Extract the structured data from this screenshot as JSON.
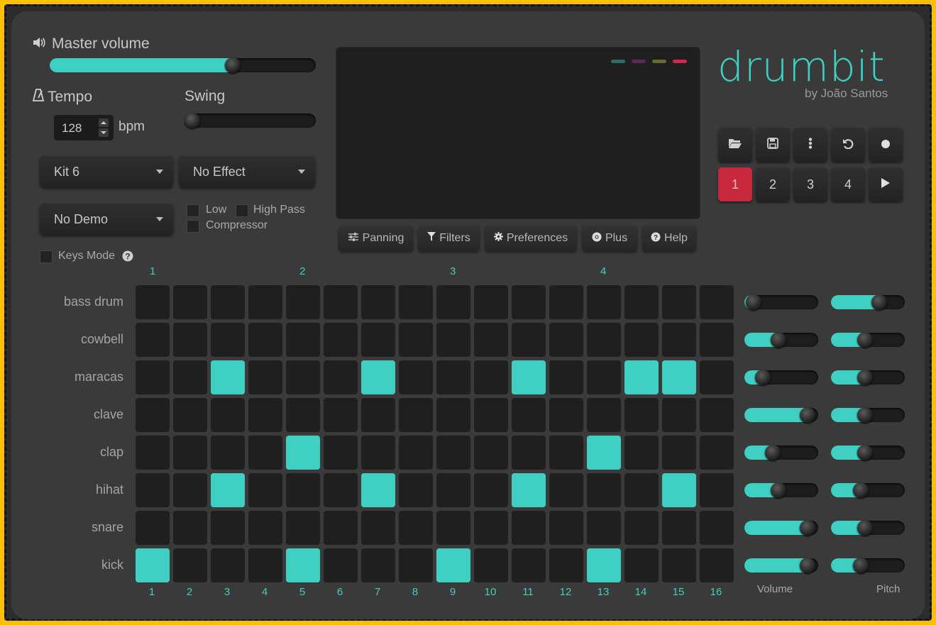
{
  "app": {
    "logo": "drumbit",
    "byline": "by João Santos",
    "accent": "#3fcfc3",
    "record_active": "#c8283b"
  },
  "master_volume": {
    "label": "Master volume",
    "icon": "speaker-icon",
    "level": 0.7
  },
  "tempo": {
    "label": "Tempo",
    "icon": "metronome-icon",
    "value": "128",
    "unit": "bpm"
  },
  "swing": {
    "label": "Swing",
    "level": 0.0
  },
  "selects": {
    "kit": "Kit 6",
    "effect": "No Effect",
    "demo": "No Demo"
  },
  "filters": {
    "low": "Low",
    "high_pass": "High Pass",
    "compressor": "Compressor"
  },
  "keys_mode": {
    "label": "Keys Mode",
    "icon": "help-icon"
  },
  "visualizer_dashes": [
    "#2f6b68",
    "#5a2a55",
    "#6a6a2e",
    "#d0284a"
  ],
  "tabs": [
    {
      "label": "Panning",
      "icon": "sliders-icon"
    },
    {
      "label": "Filters",
      "icon": "filter-icon"
    },
    {
      "label": "Preferences",
      "icon": "gear-icon"
    },
    {
      "label": "Plus",
      "icon": "chrome-icon"
    },
    {
      "label": "Help",
      "icon": "help-icon"
    }
  ],
  "toolbar_icons": [
    "folder-open-icon",
    "save-icon",
    "more-vertical-icon",
    "undo-icon",
    "record-icon"
  ],
  "patterns": [
    "1",
    "2",
    "3",
    "4"
  ],
  "active_pattern": "1",
  "beat_markers": [
    "1",
    "2",
    "3",
    "4"
  ],
  "step_numbers": [
    "1",
    "2",
    "3",
    "4",
    "5",
    "6",
    "7",
    "8",
    "9",
    "10",
    "11",
    "12",
    "13",
    "14",
    "15",
    "16"
  ],
  "tracks": [
    {
      "name": "bass drum",
      "steps": [],
      "volume": 0.02,
      "pitch": 0.7
    },
    {
      "name": "cowbell",
      "steps": [],
      "volume": 0.45,
      "pitch": 0.45
    },
    {
      "name": "maracas",
      "steps": [
        3,
        7,
        11,
        14,
        15
      ],
      "volume": 0.18,
      "pitch": 0.45
    },
    {
      "name": "clave",
      "steps": [],
      "volume": 0.95,
      "pitch": 0.45
    },
    {
      "name": "clap",
      "steps": [
        5,
        13
      ],
      "volume": 0.35,
      "pitch": 0.45
    },
    {
      "name": "hihat",
      "steps": [
        3,
        7,
        11,
        15
      ],
      "volume": 0.45,
      "pitch": 0.38
    },
    {
      "name": "snare",
      "steps": [],
      "volume": 0.95,
      "pitch": 0.45
    },
    {
      "name": "kick",
      "steps": [
        1,
        5,
        9,
        13
      ],
      "volume": 0.95,
      "pitch": 0.38
    }
  ],
  "column_heads": {
    "volume": "Volume",
    "pitch": "Pitch"
  }
}
